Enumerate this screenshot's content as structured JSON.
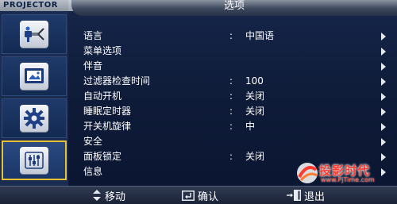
{
  "header": {
    "brand": "PROJECTOR",
    "title": "选项"
  },
  "sidebar": {
    "tabs": [
      {
        "name": "input-tab",
        "icon": "plug-connector-icon",
        "selected": false
      },
      {
        "name": "picture-tab",
        "icon": "picture-frame-icon",
        "selected": false
      },
      {
        "name": "setup-tab",
        "icon": "gear-icon",
        "selected": false
      },
      {
        "name": "options-tab",
        "icon": "sliders-icon",
        "selected": true
      }
    ]
  },
  "menu": {
    "items": [
      {
        "label": "语言",
        "value": "中国语",
        "has_value": true
      },
      {
        "label": "菜单选项",
        "value": "",
        "has_value": false
      },
      {
        "label": "伴音",
        "value": "",
        "has_value": false
      },
      {
        "label": "过滤器检查时间",
        "value": "100",
        "has_value": true
      },
      {
        "label": "自动开机",
        "value": "关闭",
        "has_value": true
      },
      {
        "label": "睡眠定时器",
        "value": "关闭",
        "has_value": true
      },
      {
        "label": "开关机旋律",
        "value": "中",
        "has_value": true
      },
      {
        "label": "安全",
        "value": "",
        "has_value": false
      },
      {
        "label": "面板锁定",
        "value": "关闭",
        "has_value": true
      },
      {
        "label": "信息",
        "value": "",
        "has_value": false
      }
    ],
    "separator": ":"
  },
  "footer": {
    "move_label": "移动",
    "confirm_label": "确认",
    "exit_label": "退出"
  },
  "watermark": {
    "title": "投影时代",
    "url": "www.PjTime.com"
  },
  "colors": {
    "accent_border": "#e8c033",
    "panel_bg": "#16264a",
    "watermark_red": "#ff3a2e"
  }
}
